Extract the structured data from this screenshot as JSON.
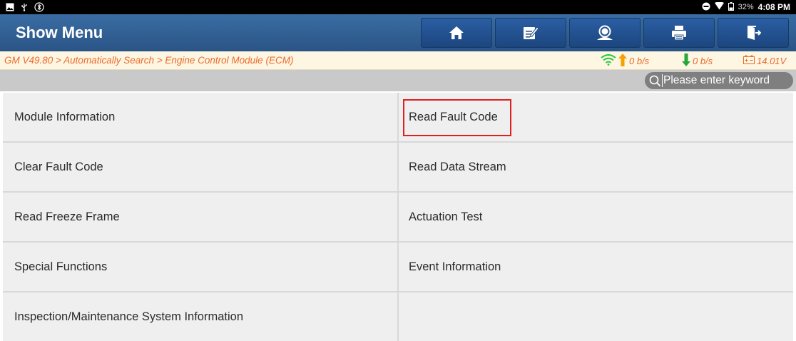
{
  "statusbar": {
    "battery_percent": "32%",
    "time": "4:08 PM"
  },
  "header": {
    "title": "Show Menu",
    "toolbar": [
      {
        "icon": "home-icon"
      },
      {
        "icon": "edit-report-icon"
      },
      {
        "icon": "remote-support-icon"
      },
      {
        "icon": "print-icon"
      },
      {
        "icon": "exit-icon"
      }
    ],
    "colors": {
      "title_bar": "#2f5f97",
      "accent": "#ee6a2a"
    }
  },
  "breadcrumb": {
    "path": "GM V49.80 > Automatically Search > Engine Control Module (ECM)",
    "upload_rate": "0 b/s",
    "download_rate": "0 b/s",
    "voltage": "14.01V"
  },
  "search": {
    "placeholder": "Please enter keyword",
    "value": ""
  },
  "menu": {
    "items": [
      {
        "label": "Module Information"
      },
      {
        "label": "Read Fault Code",
        "highlighted": true
      },
      {
        "label": "Clear Fault Code"
      },
      {
        "label": "Read Data Stream"
      },
      {
        "label": "Read Freeze Frame"
      },
      {
        "label": "Actuation Test"
      },
      {
        "label": "Special Functions"
      },
      {
        "label": "Event Information"
      },
      {
        "label": "Inspection/Maintenance System Information"
      }
    ]
  }
}
